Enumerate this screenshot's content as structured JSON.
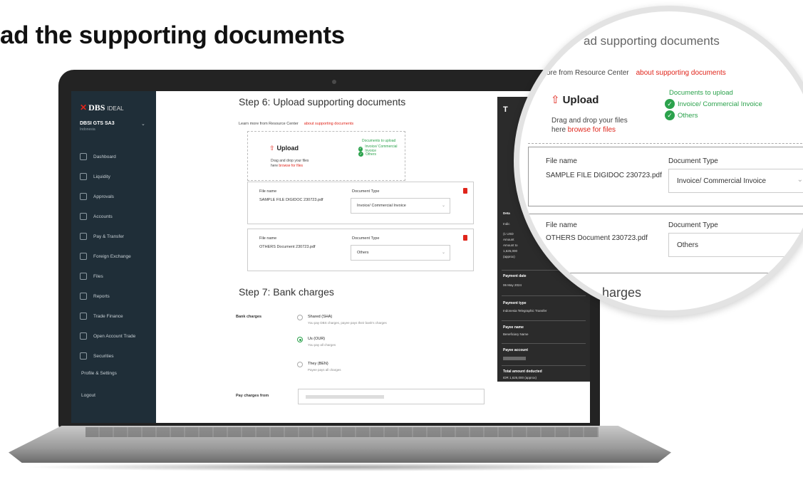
{
  "headline": "ad the supporting documents",
  "sidebar": {
    "brand": "DBS",
    "brand_suffix": "IDEAL",
    "org_name": "DBSI GTS SA3",
    "org_sub": "Indonesia",
    "items": [
      {
        "label": "Dashboard",
        "icon": "home-icon"
      },
      {
        "label": "Liquidity",
        "icon": "liquidity-icon"
      },
      {
        "label": "Approvals",
        "icon": "approvals-icon"
      },
      {
        "label": "Accounts",
        "icon": "accounts-icon"
      },
      {
        "label": "Pay & Transfer",
        "icon": "pay-transfer-icon"
      },
      {
        "label": "Foreign Exchange",
        "icon": "fx-icon"
      },
      {
        "label": "Files",
        "icon": "files-icon"
      },
      {
        "label": "Reports",
        "icon": "reports-icon"
      },
      {
        "label": "Trade Finance",
        "icon": "trade-finance-icon"
      },
      {
        "label": "Open Account Trade",
        "icon": "open-account-icon"
      },
      {
        "label": "Securities",
        "icon": "securities-icon"
      }
    ],
    "profile": "Profile & Settings",
    "logout": "Logout"
  },
  "step6": {
    "title": "Step 6: Upload supporting documents",
    "learn_text": "Learn more from Resource Center",
    "learn_link": "about supporting documents",
    "upload_title": "Upload",
    "drag_text": "Drag and drop your files",
    "drag_prefix": "here",
    "browse_link": "browse for files",
    "docs_title": "Documents to upload",
    "docs": [
      "Invoice/ Commercial Invoice",
      "Others"
    ],
    "files": [
      {
        "file_name_label": "File name",
        "file_name": "SAMPLE FILE DIGIDOC 230723.pdf",
        "doc_type_label": "Document Type",
        "doc_type": "Invoice/ Commercial Invoice"
      },
      {
        "file_name_label": "File name",
        "file_name": "OTHERS Document 230723.pdf",
        "doc_type_label": "Document Type",
        "doc_type": "Others"
      }
    ]
  },
  "step7": {
    "title": "Step 7: Bank charges",
    "label": "Bank charges",
    "options": [
      {
        "title": "Shared (SHA)",
        "sub": "You pay DBS charges, payee pays their bank's charges",
        "selected": false
      },
      {
        "title": "Us (OUR)",
        "sub": "You pay all charges",
        "selected": true
      },
      {
        "title": "They (BEN)",
        "sub": "Payee pays all charges",
        "selected": false
      }
    ],
    "pay_from_label": "Pay charges from"
  },
  "summary": {
    "title": "T",
    "fields": [
      {
        "label": "Payment date",
        "value": "06 May 2024"
      },
      {
        "label": "Payment type",
        "value": "Indonesia Telegraphic Transfer"
      },
      {
        "label": "Payee name",
        "value": "Beneficiary Name"
      },
      {
        "label": "Payee account",
        "value": ""
      },
      {
        "label": "Total amount deducted",
        "value": "IDR 1,626,000 (approx)"
      }
    ],
    "partial_lines": [
      "Deta",
      "Indic",
      "(1 USD",
      "Amount",
      "Amount to",
      "1,626,000",
      "(approx)"
    ]
  },
  "magnifier": {
    "title": "ad supporting documents",
    "learn_text": "ore from Resource Center",
    "learn_link": "about supporting documents",
    "upload_title": "Upload",
    "drag_text": "Drag and drop your files",
    "drag_prefix": "here",
    "browse_link": "browse for files",
    "docs_title": "Documents to upload",
    "docs": [
      "Invoice/ Commercial Invoice",
      "Others"
    ],
    "files": [
      {
        "file_name_label": "File name",
        "file_name": "SAMPLE FILE DIGIDOC 230723.pdf",
        "doc_type_label": "Document Type",
        "doc_type": "Invoice/ Commercial Invoice"
      },
      {
        "file_name_label": "File name",
        "file_name": "OTHERS Document 230723.pdf",
        "doc_type_label": "Document Type",
        "doc_type": "Others"
      }
    ],
    "charges_fragment": "harges"
  },
  "colors": {
    "accent_red": "#e0251b",
    "success_green": "#2ba24c",
    "sidebar_bg": "#1f2e38",
    "summary_bg": "#2b2b2b"
  }
}
